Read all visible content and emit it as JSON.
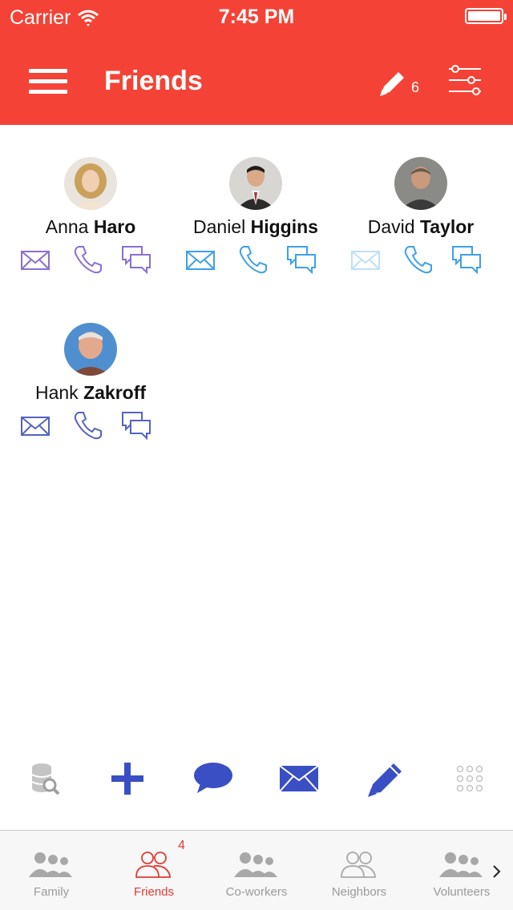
{
  "status_bar": {
    "carrier": "Carrier",
    "time": "7:45 PM"
  },
  "nav": {
    "title": "Friends",
    "edit_count": "6"
  },
  "colors": {
    "accent": "#f44336",
    "purple_icon": "#8a6fd1",
    "blue_icon": "#3ea0e8",
    "light_blue_icon": "#bfe0f6",
    "indigo_icon": "#5563c1",
    "toolbar_blue": "#3a4fc4",
    "tab_gray": "#9a9a9a",
    "tab_active": "#e53935"
  },
  "contacts": [
    {
      "first": "Anna",
      "last": "Haro",
      "icons": [
        "mail-icon",
        "phone-icon",
        "chat-icon"
      ]
    },
    {
      "first": "Daniel",
      "last": "Higgins",
      "icons": [
        "mail-icon",
        "phone-icon",
        "chat-icon"
      ]
    },
    {
      "first": "David",
      "last": "Taylor",
      "icons": [
        "mail-icon",
        "phone-icon",
        "chat-icon"
      ]
    },
    {
      "first": "Hank",
      "last": "Zakroff",
      "icons": [
        "mail-icon",
        "phone-icon",
        "chat-icon"
      ]
    }
  ],
  "toolbar": {
    "items": [
      "database-search-icon",
      "plus-icon",
      "speech-bubble-icon",
      "envelope-icon",
      "pencil-icon",
      "grid-dots-icon"
    ]
  },
  "tabs": [
    {
      "label": "Family",
      "icon": "people-icon"
    },
    {
      "label": "Friends",
      "icon": "people-outline-icon",
      "badge": "4"
    },
    {
      "label": "Co-workers",
      "icon": "people-icon"
    },
    {
      "label": "Neighbors",
      "icon": "people-outline-icon"
    },
    {
      "label": "Volunteers",
      "icon": "people-icon"
    }
  ]
}
